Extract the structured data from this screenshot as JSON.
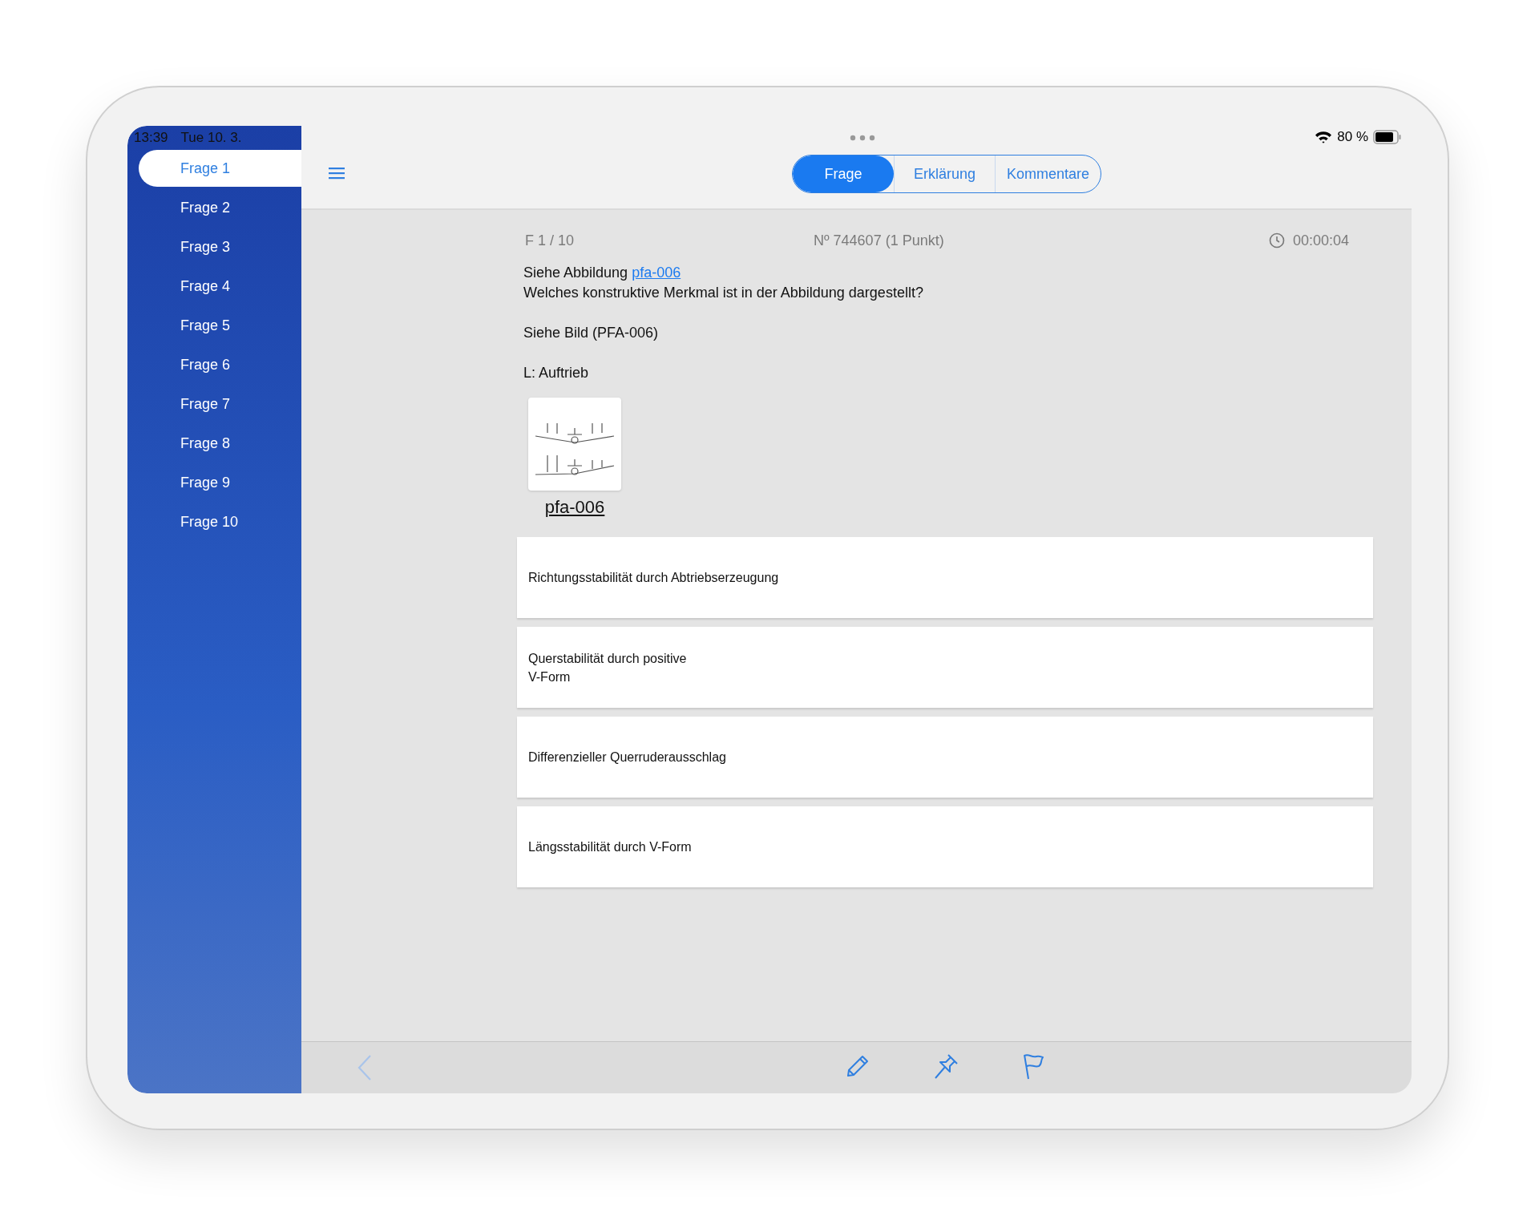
{
  "status_bar": {
    "time": "13:39",
    "date": "Tue 10. 3.",
    "battery": "80 %"
  },
  "sidebar": {
    "items": [
      {
        "label": "Frage 1",
        "selected": true
      },
      {
        "label": "Frage 2",
        "selected": false
      },
      {
        "label": "Frage 3",
        "selected": false
      },
      {
        "label": "Frage 4",
        "selected": false
      },
      {
        "label": "Frage 5",
        "selected": false
      },
      {
        "label": "Frage 6",
        "selected": false
      },
      {
        "label": "Frage 7",
        "selected": false
      },
      {
        "label": "Frage 8",
        "selected": false
      },
      {
        "label": "Frage 9",
        "selected": false
      },
      {
        "label": "Frage 10",
        "selected": false
      }
    ]
  },
  "tabs": [
    {
      "label": "Frage",
      "selected": true
    },
    {
      "label": "Erklärung",
      "selected": false
    },
    {
      "label": "Kommentare",
      "selected": false
    }
  ],
  "header": {
    "counter": "F  1 / 10",
    "number": "Nº 744607 (1 Punkt)",
    "timer": "00:00:04"
  },
  "question": {
    "intro": "Siehe Abbildung",
    "link": "pfa-006",
    "line": "Welches konstruktive Merkmal ist in der Abbildung dargestellt?",
    "paragraphs": [
      "Siehe Bild (PFA-006)",
      "L: Auftrieb"
    ]
  },
  "figure": {
    "caption": "pfa-006"
  },
  "answers": [
    {
      "text": "Richtungsstabilität durch Abtriebserzeugung"
    },
    {
      "text": "Querstabilität durch positive\nV-Form"
    },
    {
      "text": "Differenzieller Querruderausschlag"
    },
    {
      "text": "Längsstabilität durch V-Form"
    }
  ],
  "toolbar": {
    "back_disabled": true
  }
}
